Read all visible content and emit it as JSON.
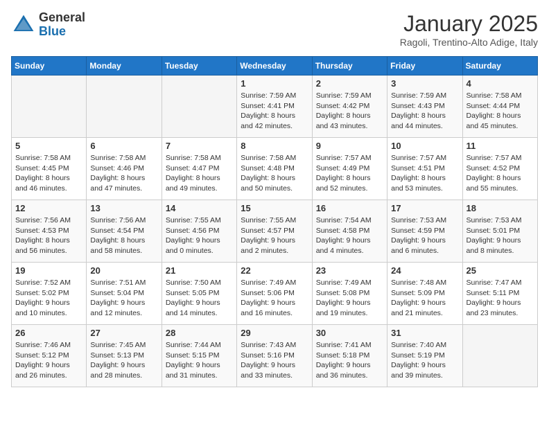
{
  "header": {
    "logo_general": "General",
    "logo_blue": "Blue",
    "month_title": "January 2025",
    "location": "Ragoli, Trentino-Alto Adige, Italy"
  },
  "days_of_week": [
    "Sunday",
    "Monday",
    "Tuesday",
    "Wednesday",
    "Thursday",
    "Friday",
    "Saturday"
  ],
  "weeks": [
    [
      {
        "day": "",
        "info": ""
      },
      {
        "day": "",
        "info": ""
      },
      {
        "day": "",
        "info": ""
      },
      {
        "day": "1",
        "info": "Sunrise: 7:59 AM\nSunset: 4:41 PM\nDaylight: 8 hours and 42 minutes."
      },
      {
        "day": "2",
        "info": "Sunrise: 7:59 AM\nSunset: 4:42 PM\nDaylight: 8 hours and 43 minutes."
      },
      {
        "day": "3",
        "info": "Sunrise: 7:59 AM\nSunset: 4:43 PM\nDaylight: 8 hours and 44 minutes."
      },
      {
        "day": "4",
        "info": "Sunrise: 7:58 AM\nSunset: 4:44 PM\nDaylight: 8 hours and 45 minutes."
      }
    ],
    [
      {
        "day": "5",
        "info": "Sunrise: 7:58 AM\nSunset: 4:45 PM\nDaylight: 8 hours and 46 minutes."
      },
      {
        "day": "6",
        "info": "Sunrise: 7:58 AM\nSunset: 4:46 PM\nDaylight: 8 hours and 47 minutes."
      },
      {
        "day": "7",
        "info": "Sunrise: 7:58 AM\nSunset: 4:47 PM\nDaylight: 8 hours and 49 minutes."
      },
      {
        "day": "8",
        "info": "Sunrise: 7:58 AM\nSunset: 4:48 PM\nDaylight: 8 hours and 50 minutes."
      },
      {
        "day": "9",
        "info": "Sunrise: 7:57 AM\nSunset: 4:49 PM\nDaylight: 8 hours and 52 minutes."
      },
      {
        "day": "10",
        "info": "Sunrise: 7:57 AM\nSunset: 4:51 PM\nDaylight: 8 hours and 53 minutes."
      },
      {
        "day": "11",
        "info": "Sunrise: 7:57 AM\nSunset: 4:52 PM\nDaylight: 8 hours and 55 minutes."
      }
    ],
    [
      {
        "day": "12",
        "info": "Sunrise: 7:56 AM\nSunset: 4:53 PM\nDaylight: 8 hours and 56 minutes."
      },
      {
        "day": "13",
        "info": "Sunrise: 7:56 AM\nSunset: 4:54 PM\nDaylight: 8 hours and 58 minutes."
      },
      {
        "day": "14",
        "info": "Sunrise: 7:55 AM\nSunset: 4:56 PM\nDaylight: 9 hours and 0 minutes."
      },
      {
        "day": "15",
        "info": "Sunrise: 7:55 AM\nSunset: 4:57 PM\nDaylight: 9 hours and 2 minutes."
      },
      {
        "day": "16",
        "info": "Sunrise: 7:54 AM\nSunset: 4:58 PM\nDaylight: 9 hours and 4 minutes."
      },
      {
        "day": "17",
        "info": "Sunrise: 7:53 AM\nSunset: 4:59 PM\nDaylight: 9 hours and 6 minutes."
      },
      {
        "day": "18",
        "info": "Sunrise: 7:53 AM\nSunset: 5:01 PM\nDaylight: 9 hours and 8 minutes."
      }
    ],
    [
      {
        "day": "19",
        "info": "Sunrise: 7:52 AM\nSunset: 5:02 PM\nDaylight: 9 hours and 10 minutes."
      },
      {
        "day": "20",
        "info": "Sunrise: 7:51 AM\nSunset: 5:04 PM\nDaylight: 9 hours and 12 minutes."
      },
      {
        "day": "21",
        "info": "Sunrise: 7:50 AM\nSunset: 5:05 PM\nDaylight: 9 hours and 14 minutes."
      },
      {
        "day": "22",
        "info": "Sunrise: 7:49 AM\nSunset: 5:06 PM\nDaylight: 9 hours and 16 minutes."
      },
      {
        "day": "23",
        "info": "Sunrise: 7:49 AM\nSunset: 5:08 PM\nDaylight: 9 hours and 19 minutes."
      },
      {
        "day": "24",
        "info": "Sunrise: 7:48 AM\nSunset: 5:09 PM\nDaylight: 9 hours and 21 minutes."
      },
      {
        "day": "25",
        "info": "Sunrise: 7:47 AM\nSunset: 5:11 PM\nDaylight: 9 hours and 23 minutes."
      }
    ],
    [
      {
        "day": "26",
        "info": "Sunrise: 7:46 AM\nSunset: 5:12 PM\nDaylight: 9 hours and 26 minutes."
      },
      {
        "day": "27",
        "info": "Sunrise: 7:45 AM\nSunset: 5:13 PM\nDaylight: 9 hours and 28 minutes."
      },
      {
        "day": "28",
        "info": "Sunrise: 7:44 AM\nSunset: 5:15 PM\nDaylight: 9 hours and 31 minutes."
      },
      {
        "day": "29",
        "info": "Sunrise: 7:43 AM\nSunset: 5:16 PM\nDaylight: 9 hours and 33 minutes."
      },
      {
        "day": "30",
        "info": "Sunrise: 7:41 AM\nSunset: 5:18 PM\nDaylight: 9 hours and 36 minutes."
      },
      {
        "day": "31",
        "info": "Sunrise: 7:40 AM\nSunset: 5:19 PM\nDaylight: 9 hours and 39 minutes."
      },
      {
        "day": "",
        "info": ""
      }
    ]
  ]
}
